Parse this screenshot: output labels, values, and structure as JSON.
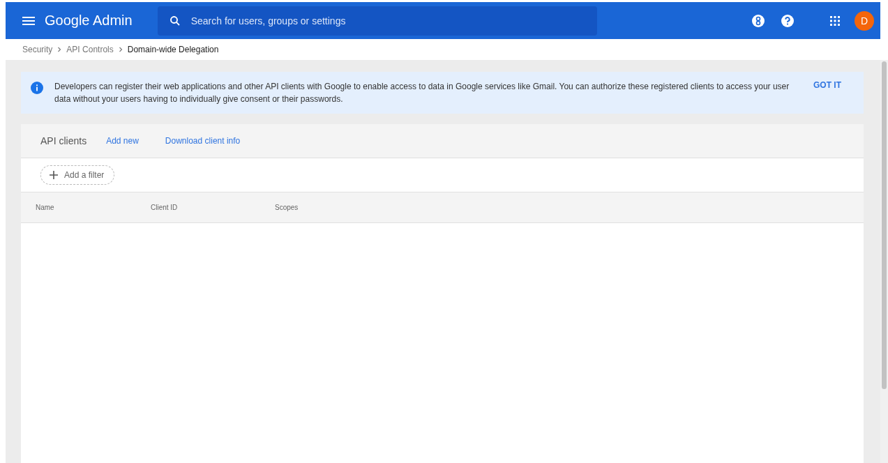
{
  "header": {
    "product": "Google Admin",
    "search": {
      "placeholder": "Search for users, groups or settings"
    },
    "avatar": "D"
  },
  "breadcrumb": [
    {
      "label": "Security",
      "current": false
    },
    {
      "label": "API Controls",
      "current": false
    },
    {
      "label": "Domain-wide Delegation",
      "current": true
    }
  ],
  "banner": {
    "text": "Developers can register their web applications and other API clients with Google to enable access to data in Google services like Gmail. You can authorize these registered clients to access your user data without your users having to individually give consent or their passwords.",
    "action": "GOT IT"
  },
  "panel": {
    "title": "API clients",
    "actions": [
      "Add new",
      "Download client info"
    ],
    "filter": "Add a filter",
    "columns": [
      "Name",
      "Client ID",
      "Scopes"
    ]
  }
}
